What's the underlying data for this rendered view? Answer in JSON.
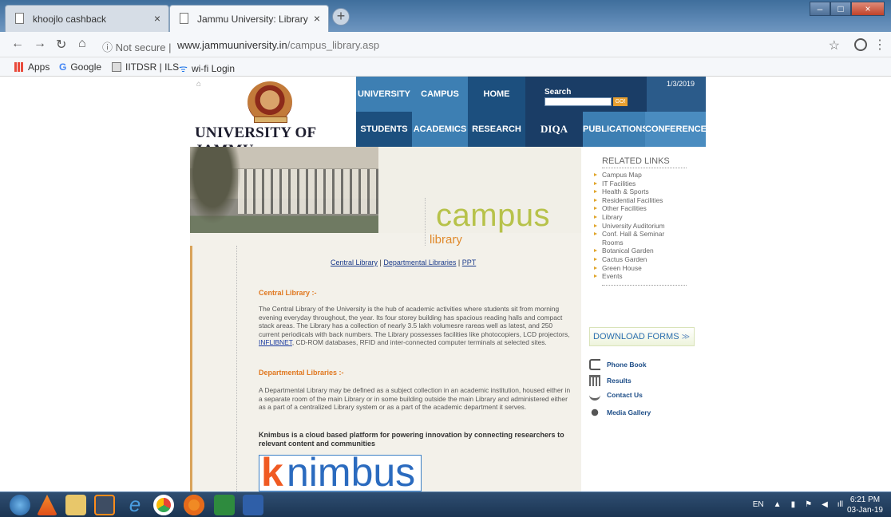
{
  "browser": {
    "tabs": [
      {
        "label": "khoojlo cashback",
        "active": false
      },
      {
        "label": "Jammu University: Library",
        "active": true
      }
    ],
    "new_tab": "+",
    "security": "Not secure",
    "url_host": "www.jammuuniversity.in",
    "url_path": "/campus_library.asp",
    "bookmarks": [
      "Apps",
      "Google",
      "IITDSR | ILS",
      "wi-fi Login"
    ]
  },
  "site": {
    "title": "UNIVERSITY OF JAMMU",
    "date": "1/3/2019",
    "nav": {
      "university": "UNIVERSITY",
      "campus": "CAMPUS",
      "home": "HOME",
      "students": "STUDENTS",
      "academics": "ACADEMICS",
      "research": "RESEARCH",
      "diqa": "DIQA",
      "publications": "PUBLICATIONS",
      "conferences": "CONFERENCES"
    },
    "search": {
      "label": "Search",
      "go": "GO!"
    },
    "banner": {
      "campus": "campus",
      "library": "library"
    },
    "sublinks": {
      "central": "Central Library",
      "departmental": "Departmental Libraries",
      "ppt": "PPT",
      "sep": " | "
    },
    "central": {
      "heading": "Central Library :-",
      "text_a": "The Central Library of the University is the hub of academic activities where students sit from morning evening everyday throughout, the year. Its four storey building has spacious reading halls and compact stack areas. The Library has a collection of nearly 3.5 lakh volumesre rareas well as latest, and 250 current periodicals with back numbers. The Library possesses facilities like photocopiers, LCD projectors, ",
      "link": "INFLIBNET",
      "text_b": ", CD-ROM databases, RFID and inter-connected computer terminals at selected sites."
    },
    "departmental": {
      "heading": "Departmental Libraries :-",
      "text": "A Departmental Library may be defined as a subject collection in an academic institution, housed either in a separate room of the main Library or in some building outside the main Library and administered either as a part of a centralized Library system or as a part of the academic department it serves."
    },
    "knimbus": {
      "text": "Knimbus is a cloud based platform for powering innovation by connecting researchers to relevant content and communities",
      "logo_k": "k",
      "logo_rest": "nimbus"
    },
    "related": {
      "title": "RELATED LINKS",
      "items": [
        "Campus Map",
        "IT Facilities",
        "Health & Sports",
        "Residential Facilities",
        "Other Facilities",
        "Library",
        "University Auditorium",
        "Conf. Hall & Seminar Rooms",
        "Botanical Garden",
        "Cactus Garden",
        "Green House",
        "Events"
      ]
    },
    "download_forms": "DOWNLOAD FORMS",
    "side_links": [
      "Phone Book",
      "Results",
      "Contact Us",
      "Media Gallery"
    ]
  },
  "taskbar": {
    "lang": "EN",
    "time": "6:21 PM",
    "date": "03-Jan-19"
  }
}
